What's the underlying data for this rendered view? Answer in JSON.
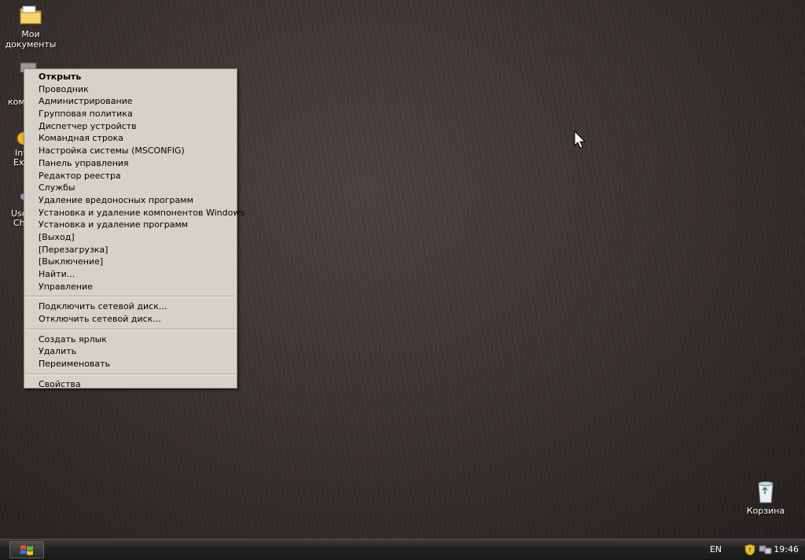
{
  "desktop_icons": {
    "my_documents": {
      "line1": "Мои",
      "line2": "документы"
    },
    "recycle_bin": {
      "label": "Корзина"
    },
    "partial_labels": [
      "кoм",
      "Int",
      "Ex",
      "Use",
      "Ch"
    ]
  },
  "context_menu": {
    "group1": [
      "Открыть",
      "Проводник",
      "Администрирование",
      "Групповая политика",
      "Диспетчер устройств",
      "Командная строка",
      "Настройка системы (MSCONFIG)",
      "Панель управления",
      "Редактор реестра",
      "Службы",
      "Удаление вредоносных программ",
      "Установка и удаление компонентов Windows",
      "Установка и удаление программ",
      "[Выход]",
      "[Перезагрузка]",
      "[Выключение]",
      "Найти...",
      "Управление"
    ],
    "group2": [
      "Подключить сетевой диск...",
      "Отключить сетевой диск..."
    ],
    "group3": [
      "Создать ярлык",
      "Удалить",
      "Переименовать"
    ],
    "group4": [
      "Свойства"
    ]
  },
  "taskbar": {
    "language": "EN",
    "clock": "19:46"
  },
  "icons": {
    "start": "windows-flag-icon",
    "tray": [
      "security-shield-icon",
      "network-icon"
    ]
  },
  "colors": {
    "menu_bg": "#d6d2c8",
    "taskbar_bg": "#232323",
    "desktop_bg": "#3b3431"
  }
}
